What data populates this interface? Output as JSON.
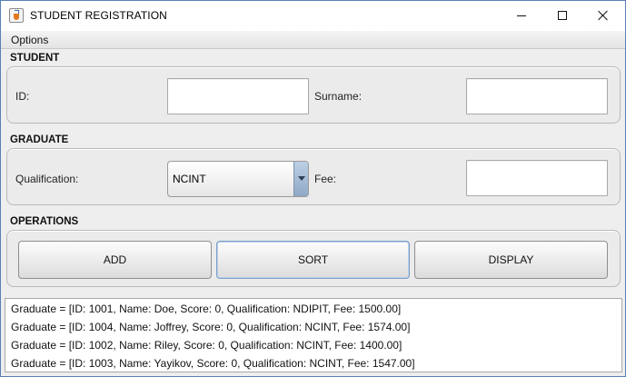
{
  "window": {
    "title": "STUDENT REGISTRATION"
  },
  "menubar": {
    "options_label": "Options"
  },
  "student": {
    "section_label": "STUDENT",
    "id_label": "ID:",
    "id_value": "",
    "surname_label": "Surname:",
    "surname_value": ""
  },
  "graduate": {
    "section_label": "GRADUATE",
    "qualification_label": "Qualification:",
    "qualification_selected": "NCINT",
    "fee_label": "Fee:",
    "fee_value": ""
  },
  "operations": {
    "section_label": "OPERATIONS",
    "add_label": "ADD",
    "sort_label": "SORT",
    "display_label": "DISPLAY"
  },
  "output": {
    "lines": [
      "Graduate = [ID: 1001, Name: Doe, Score: 0, Qualification: NDIPIT, Fee: 1500.00]",
      "Graduate = [ID: 1004, Name: Joffrey, Score: 0, Qualification: NCINT, Fee: 1574.00]",
      "Graduate = [ID: 1002, Name: Riley, Score: 0, Qualification: NCINT, Fee: 1400.00]",
      "Graduate = [ID: 1003, Name: Yayikov, Score: 0, Qualification: NCINT, Fee: 1547.00]"
    ]
  },
  "colors": {
    "window_border": "#5a7fb5",
    "panel_background": "#ebebeb",
    "select_arrow": "#8fa8c6"
  }
}
